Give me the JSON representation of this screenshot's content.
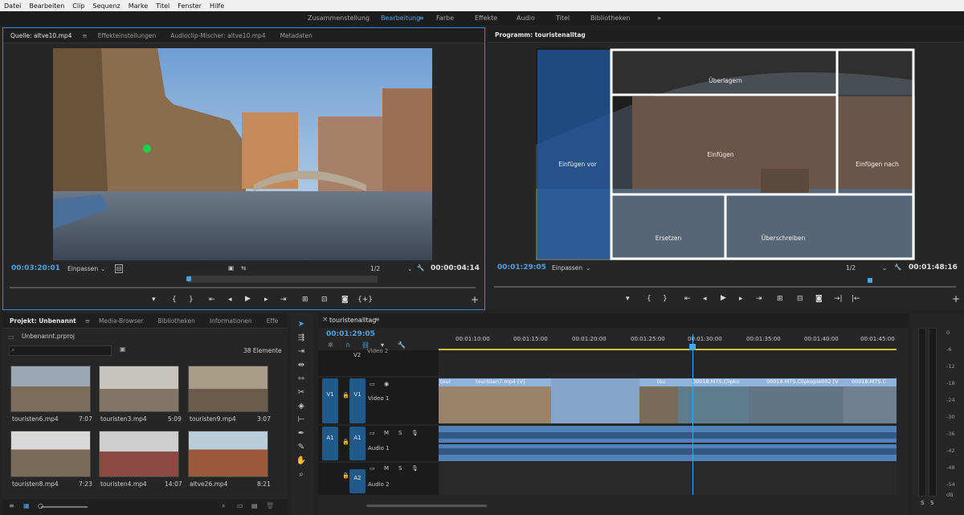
{
  "menu": [
    "Datei",
    "Bearbeiten",
    "Clip",
    "Sequenz",
    "Marke",
    "Titel",
    "Fenster",
    "Hilfe"
  ],
  "workspaces": {
    "items": [
      "Zusammenstellung",
      "Bearbeitung",
      "Farbe",
      "Effekte",
      "Audio",
      "Titel",
      "Bibliotheken"
    ],
    "active": "Bearbeitung",
    "more": "»"
  },
  "source": {
    "tabs": [
      "Quelle: altve10.mp4",
      "Effekteinstellungen",
      "Audioclip-Mischer: altve10.mp4",
      "Metadaten"
    ],
    "timecode": "00:03:20:01",
    "fit": "Einpassen",
    "scale": "1/2",
    "duration": "00:00:04:14"
  },
  "program": {
    "title": "Programm: touristenalltag",
    "timecode": "00:01:29:05",
    "fit": "Einpassen",
    "scale": "1/2",
    "duration": "00:01:48:16",
    "overlay": {
      "top": "Überlagern",
      "left": "Einfügen vor",
      "center": "Einfügen",
      "right": "Einfügen nach",
      "bottom_left": "Ersetzen",
      "bottom_right": "Überschreiben"
    }
  },
  "project": {
    "tabs": [
      "Projekt: Unbenannt",
      "Media-Browser",
      "Bibliotheken",
      "Informationen",
      "Effe"
    ],
    "file": "Unbenannt.prproj",
    "count": "38 Elemente",
    "items": [
      {
        "name": "touristen6.mp4",
        "dur": "7:07"
      },
      {
        "name": "touristen3.mp4",
        "dur": "5:09"
      },
      {
        "name": "touristen9.mp4",
        "dur": "3:07"
      },
      {
        "name": "touristen8.mp4",
        "dur": "7:23"
      },
      {
        "name": "touristen4.mp4",
        "dur": "14:07"
      },
      {
        "name": "altve26.mp4",
        "dur": "8:21"
      }
    ]
  },
  "timeline": {
    "title": "touristenalltag",
    "timecode": "00:01:29:05",
    "ruler": [
      "00:01:10:00",
      "00:01:15:00",
      "00:01:20:00",
      "00:01:25:00",
      "00:01:30:00",
      "00:01:35:00",
      "00:01:40:00",
      "00:01:45:00"
    ],
    "tracks": {
      "v2": "V2",
      "video2": "Video 2",
      "v1": "V1",
      "video1": "Video 1",
      "a1": "A1",
      "audio1": "Audio 1",
      "a2": "A2",
      "audio2": "Audio 2"
    },
    "clips": [
      "tour",
      "touristen7.mp4 [V]",
      "tou",
      "00018.MTS.Clipko",
      "00018.MTS.Clipkople002 [V",
      "00018.MTS.C"
    ]
  },
  "meter": {
    "labels": [
      "0",
      "-6",
      "-12",
      "-18",
      "-24",
      "-30",
      "-36",
      "-42",
      "-48",
      "-54",
      "dB"
    ],
    "solo": "S"
  },
  "colors": {
    "accent": "#2d8ceb",
    "panel": "#262626",
    "track_video": "#8fb3dd",
    "track_audio": "#4f80b8",
    "track_label": "#1f5a8a"
  },
  "icons": [
    "play-icon",
    "step-back-icon",
    "step-forward-icon",
    "wrench-icon",
    "camera-icon",
    "plus-icon",
    "marker-icon",
    "magnet-icon",
    "search-icon",
    "pen-icon",
    "hand-icon",
    "razor-icon",
    "selection-icon",
    "folder-icon",
    "eye-icon",
    "lock-icon",
    "mic-icon"
  ]
}
